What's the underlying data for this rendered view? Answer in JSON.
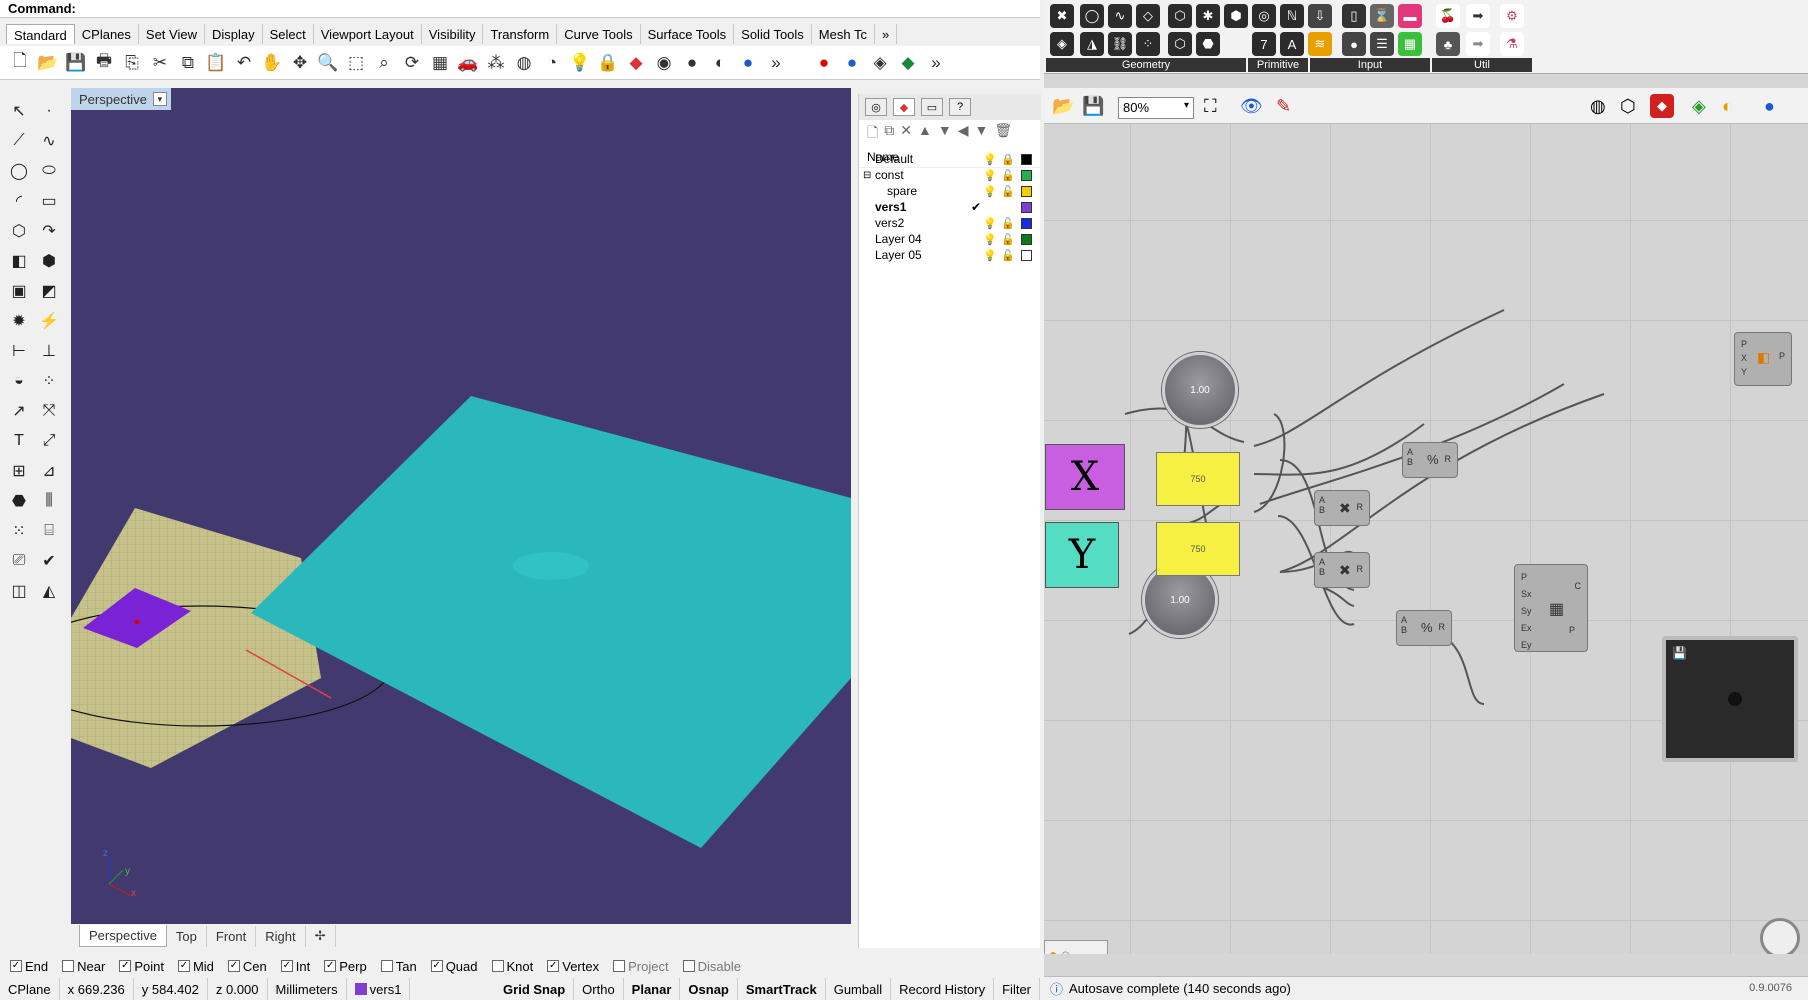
{
  "command": {
    "label": "Command:"
  },
  "tabs": [
    "Standard",
    "CPlanes",
    "Set View",
    "Display",
    "Select",
    "Viewport Layout",
    "Visibility",
    "Transform",
    "Curve Tools",
    "Surface Tools",
    "Solid Tools",
    "Mesh Tc"
  ],
  "viewport": {
    "title": "Perspective",
    "tabs": [
      "Perspective",
      "Top",
      "Front",
      "Right"
    ]
  },
  "layers": {
    "header": "Name",
    "rows": [
      {
        "name": "Default",
        "color": "#000000"
      },
      {
        "name": "const",
        "color": "#22b14c"
      },
      {
        "name": "spare",
        "color": "#f0d000"
      },
      {
        "name": "vers1",
        "color": "#7f3fd0",
        "current": true
      },
      {
        "name": "vers2",
        "color": "#1a2ae0"
      },
      {
        "name": "Layer 04",
        "color": "#0a7a1a"
      },
      {
        "name": "Layer 05",
        "color": "#ffffff"
      }
    ]
  },
  "osnap": [
    {
      "label": "End",
      "checked": true
    },
    {
      "label": "Near",
      "checked": false
    },
    {
      "label": "Point",
      "checked": true
    },
    {
      "label": "Mid",
      "checked": true
    },
    {
      "label": "Cen",
      "checked": true
    },
    {
      "label": "Int",
      "checked": true
    },
    {
      "label": "Perp",
      "checked": true
    },
    {
      "label": "Tan",
      "checked": false
    },
    {
      "label": "Quad",
      "checked": true
    },
    {
      "label": "Knot",
      "checked": false
    },
    {
      "label": "Vertex",
      "checked": true
    },
    {
      "label": "Project",
      "checked": false
    },
    {
      "label": "Disable",
      "checked": false
    }
  ],
  "status": {
    "cplane": "CPlane",
    "x": "x 669.236",
    "y": "y 584.402",
    "z": "z 0.000",
    "units": "Millimeters",
    "layer": "vers1",
    "toggles": [
      "Grid Snap",
      "Ortho",
      "Planar",
      "Osnap",
      "SmartTrack",
      "Gumball",
      "Record History",
      "Filter"
    ]
  },
  "grasshopper": {
    "categories": [
      "Geometry",
      "Primitive",
      "Input",
      "Util"
    ],
    "zoom": "80%",
    "sliders": [
      "1.00",
      "1.00"
    ],
    "panels": [
      "750",
      "750"
    ],
    "params": [
      "X",
      "Y"
    ],
    "status": "Autosave complete (140 seconds ago)",
    "version": "0.9.0076"
  },
  "colors": {
    "viewport_bg": "#423a6e",
    "surface": "#2ab8bc",
    "purple": "#7a22d6",
    "param_x": "#c85ee0",
    "param_y": "#55ddc4",
    "panel": "#f5f042"
  }
}
